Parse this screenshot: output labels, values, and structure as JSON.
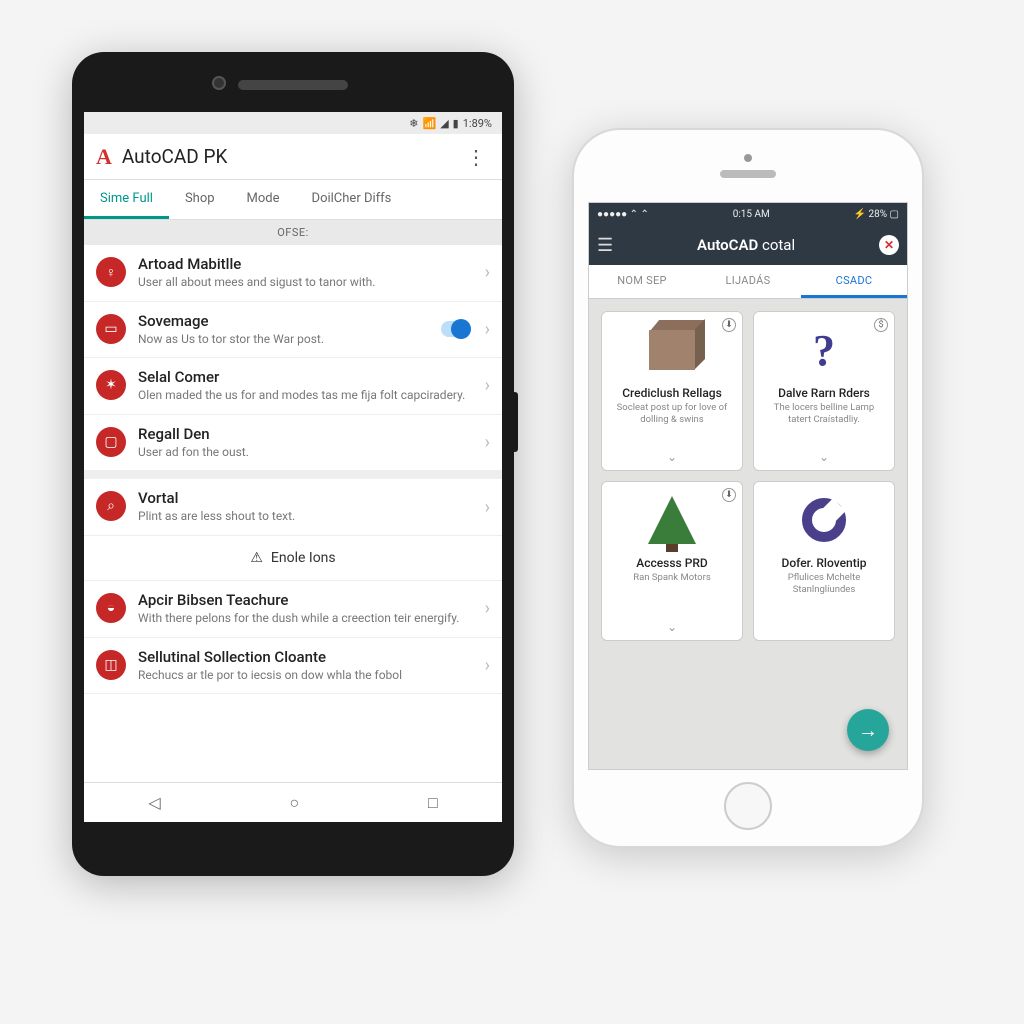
{
  "android": {
    "status": {
      "battery": "1:89%"
    },
    "toolbar": {
      "logo": "A",
      "title": "AutoCAD PK",
      "overflow_icon": "⋮"
    },
    "tabs": [
      {
        "label": "Sime Full",
        "active": true
      },
      {
        "label": "Shop",
        "active": false
      },
      {
        "label": "Mode",
        "active": false
      },
      {
        "label": "DoilCher Diffs",
        "active": false
      }
    ],
    "section_header": "OFSE:",
    "items": [
      {
        "icon": "bulb-icon",
        "glyph": "💡",
        "title": "Artoad Mabitlle",
        "sub": "User all about mees and sigust to tanor with.",
        "toggle": false
      },
      {
        "icon": "card-icon",
        "glyph": "📇",
        "title": "Sovemage",
        "sub": "Now as Us to tor stor the War post.",
        "toggle": true
      },
      {
        "icon": "wand-icon",
        "glyph": "✦",
        "title": "Selal Comer",
        "sub": "Olen maded the us for and modes tas me fija folt capciradery.",
        "toggle": false
      },
      {
        "icon": "briefcase-icon",
        "glyph": "🗓",
        "title": "Regall Den",
        "sub": "User ad fon the oust.",
        "toggle": false
      }
    ],
    "items2": [
      {
        "icon": "search-icon",
        "glyph": "🔍",
        "title": "Vortal",
        "sub": "Plint as are less shout to text."
      }
    ],
    "enole": {
      "icon": "⚠",
      "label": "Enole Ions"
    },
    "items3": [
      {
        "icon": "cloud-icon",
        "glyph": "☁",
        "title": "Apcir Bibsen Teachure",
        "sub": "With there pelons for the dush while a creection teir energify."
      },
      {
        "icon": "bag-icon",
        "glyph": "👜",
        "title": "Sellutinal Sollection Cloante",
        "sub": "Rechucs ar tle por to iecsis on dow whla the fobol"
      }
    ],
    "nav": {
      "back": "◁",
      "home": "○",
      "recent": "□"
    }
  },
  "ios": {
    "status": {
      "left": "●●●●● ⌃ ⌃",
      "time": "0:15 AM",
      "right": "⚡ 28% ▢"
    },
    "navbar": {
      "title_bold": "AutoCAD",
      "title_rest": " cotal"
    },
    "tabs": [
      {
        "label": "NOM SEP",
        "active": false
      },
      {
        "label": "LIJADÁS",
        "active": false
      },
      {
        "label": "CSADC",
        "active": true
      }
    ],
    "cards": [
      {
        "title": "Crediclush Rellags",
        "sub": "Socleat post up for love of dolling & swins",
        "img": "box",
        "badge": "⬇"
      },
      {
        "title": "Dalve Rarn Rders",
        "sub": "The locers belline Lamp tatert Craístadliy.",
        "img": "qmark",
        "badge": "$"
      },
      {
        "title": "Accesss PRD",
        "sub": "Ran Spank Motors",
        "img": "tree",
        "badge": "⬇"
      },
      {
        "title": "Dofer. Rloventip",
        "sub": "Pflulices Mchelte Stanlnglíundes",
        "img": "donut",
        "badge": ""
      }
    ],
    "fab": "→"
  }
}
